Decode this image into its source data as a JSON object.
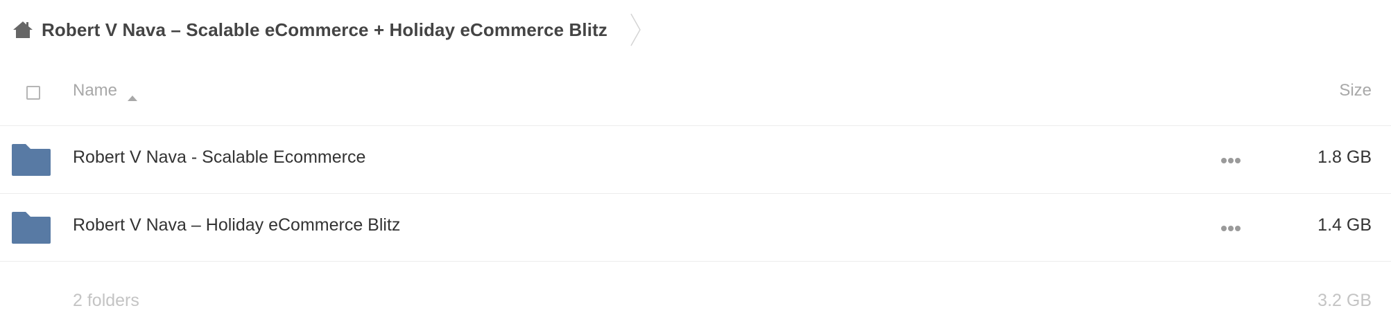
{
  "breadcrumb": {
    "home_icon": "home-icon",
    "title": "Robert V Nava – Scalable eCommerce + Holiday eCommerce Blitz",
    "separator_icon": "chevron-right-icon"
  },
  "header": {
    "select_all_icon": "checkbox",
    "name_label": "Name",
    "sort_icon": "sort-ascending-icon",
    "size_label": "Size"
  },
  "items": [
    {
      "icon": "folder-icon",
      "name": "Robert V Nava - Scalable Ecommerce",
      "size": "1.8 GB",
      "more_icon": "more-options-icon"
    },
    {
      "icon": "folder-icon",
      "name": "Robert V Nava – Holiday eCommerce Blitz",
      "size": "1.4 GB",
      "more_icon": "more-options-icon"
    }
  ],
  "footer": {
    "count": "2 folders",
    "total_size": "3.2 GB"
  },
  "colors": {
    "folder": "#587aa4",
    "text": "#333333",
    "muted": "#a8a8a8",
    "footer": "#c4c4c4",
    "divider": "#ececec"
  }
}
